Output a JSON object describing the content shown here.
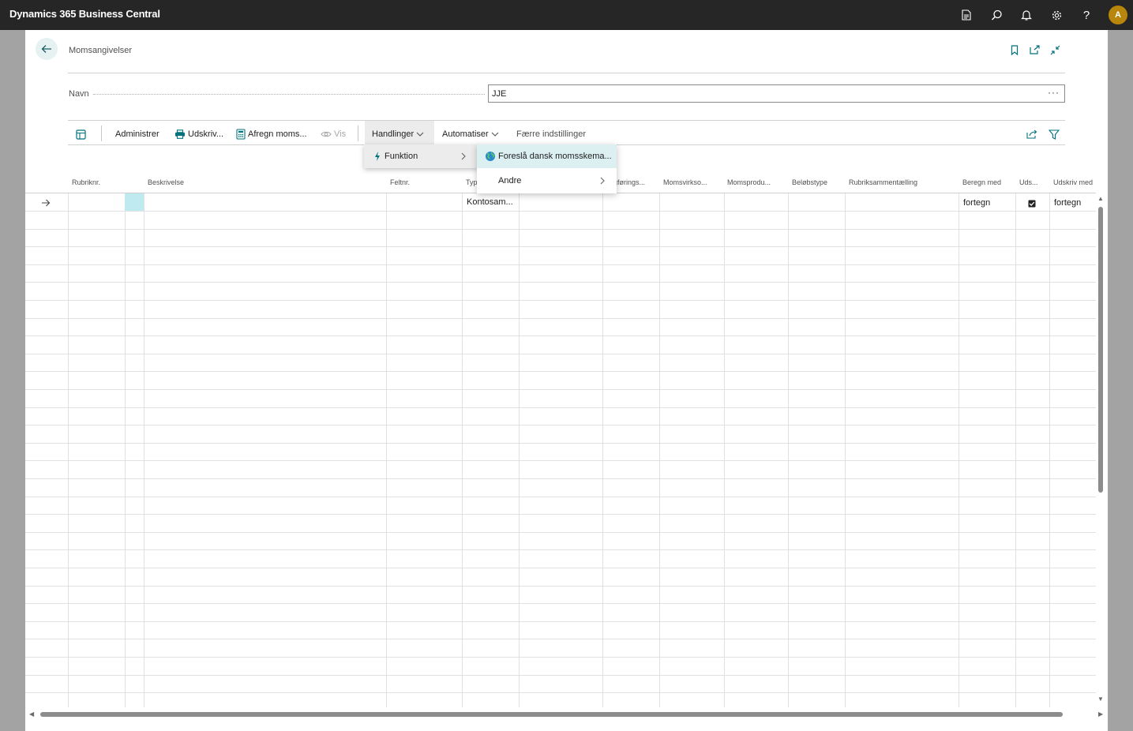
{
  "app": {
    "title": "Dynamics 365 Business Central",
    "user_initial": "A"
  },
  "page": {
    "title": "Momsangivelser"
  },
  "form": {
    "navn_label": "Navn",
    "navn_value": "JJE",
    "navn_more": "···"
  },
  "toolbar": {
    "administrer": "Administrer",
    "udskriv": "Udskriv...",
    "afregn": "Afregn moms...",
    "vis": "Vis",
    "handlinger": "Handlinger",
    "automatiser": "Automatiser",
    "faerre": "Færre indstillinger"
  },
  "menu": {
    "funktion": "Funktion",
    "foresla": "Foreslå dansk momsskema...",
    "andre": "Andre"
  },
  "columns": {
    "rubriknr": "Rubriknr.",
    "beskrivelse": "Beskrivelse",
    "feltnr": "Feltnr.",
    "type": "Typ",
    "bogforing": "gførings...",
    "momsvirk": "Momsvirkso...",
    "momsprod": "Momsprodu...",
    "belobstype": "Beløbstype",
    "rubriksam": "Rubriksammentælling",
    "beregn": "Beregn med",
    "uds": "Uds...",
    "udskrivmed": "Udskriv med"
  },
  "row": {
    "type": "Kontosam...",
    "beregn": "fortegn",
    "udskrivmed": "fortegn",
    "checked": true
  },
  "colors": {
    "topbar": "#262626",
    "accent": "#00727e",
    "selection": "#bfeaef",
    "avatar": "#b8860b"
  },
  "icons": [
    "page-icon",
    "search-icon",
    "bell-icon",
    "gear-icon",
    "help-icon",
    "back-arrow-icon",
    "bookmark-icon",
    "open-new-icon",
    "collapse-icon",
    "share-icon",
    "filter-icon",
    "printer-icon",
    "calculator-icon",
    "eye-icon",
    "lightning-icon",
    "globe-icon",
    "chevron-right-icon",
    "chevron-down-icon",
    "row-arrow-icon",
    "checkbox-icon"
  ]
}
